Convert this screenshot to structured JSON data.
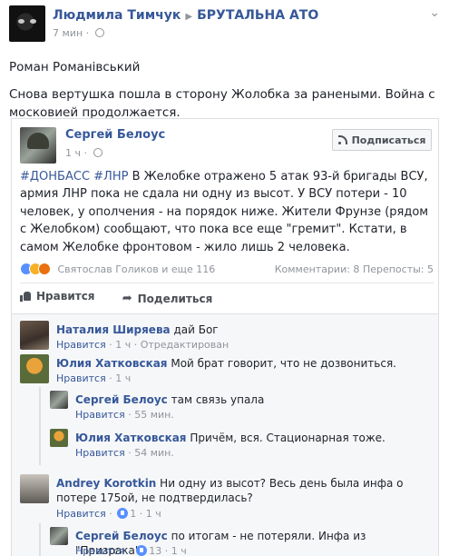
{
  "post": {
    "author": "Людмила Тимчук",
    "group": "БРУТАЛЬНА АТО",
    "time": "7 мин",
    "text_line1": "Роман Романівський",
    "text_line2": "Снова вертушка пошла в сторону Жолобка за ранеными. Война с московией продолжается."
  },
  "shared": {
    "author": "Сергей Белоус",
    "time": "1 ч",
    "subscribe_label": "Подписаться",
    "hashtags": "#ДОНБАСС #ЛНР",
    "text": "В Желобке отражено 5 атак 93-й бригады ВСУ, армия ЛНР пока не сдала ни одну из высот. У ВСУ потери - 10 человек, у ополчения - на порядок ниже. Жители Фрунзе (рядом с Желобком) сообщают, что пока все еще \"гремит\". Кстати, в самом Желобке фронтовом - жило лишь 2 человека.",
    "reaction_names": "Святослав Голиков и еще 116",
    "comments_count": "Комментарии: 8",
    "shares_count": "Перепосты: 5",
    "like_label": "Нравится",
    "share_label": "Поделиться"
  },
  "comments": [
    {
      "name": "Наталия Ширяева",
      "text": "дай Бог",
      "like": "Нравится",
      "time": "1 ч",
      "extra": "Отредактирован"
    },
    {
      "name": "Юлия Хатковская",
      "text": "Мой брат говорит, что не дозвониться.",
      "like": "Нравится",
      "time": "1 ч"
    },
    {
      "name": "Сергей Белоус",
      "text": "там связь упала",
      "like": "Нравится",
      "time": "55 мин."
    },
    {
      "name": "Юлия Хатковская",
      "text": "Причём, вся. Стационарная тоже.",
      "like": "Нравится",
      "time": "54 мин."
    },
    {
      "name": "Andrey Korotkin",
      "text": "Ни одну из высот? Весь день была инфа о потере 175ой, не подтвердилась?",
      "like": "Нравится",
      "likes": "1",
      "time": "1 ч"
    },
    {
      "name": "Сергей Белоус",
      "text": "по итогам - не потеряли. Инфа из \"Призрака\"",
      "like": "Нравится",
      "likes": "13",
      "time": "1 ч"
    }
  ],
  "colors": {
    "link": "#365899",
    "muted": "#90949c",
    "like_blue": "#5890ff"
  }
}
